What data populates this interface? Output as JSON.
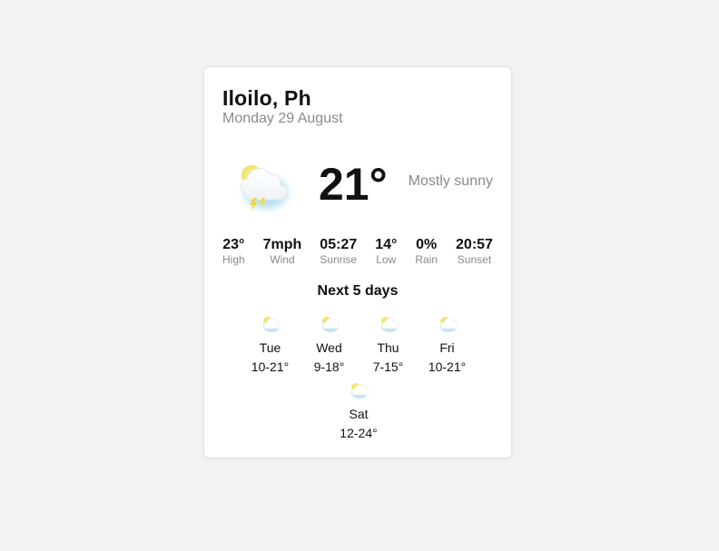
{
  "location": {
    "city": "Iloilo, Ph",
    "date": "Monday 29 August"
  },
  "current": {
    "icon": "partly-cloudy-thunder-icon",
    "temperature": "21°",
    "summary": "Mostly sunny"
  },
  "stats": [
    {
      "value": "23°",
      "label": "High"
    },
    {
      "value": "7mph",
      "label": "Wind"
    },
    {
      "value": "05:27",
      "label": "Sunrise"
    },
    {
      "value": "14°",
      "label": "Low"
    },
    {
      "value": "0%",
      "label": "Rain"
    },
    {
      "value": "20:57",
      "label": "Sunset"
    }
  ],
  "forecast_title": "Next 5 days",
  "forecast": [
    {
      "day": "Tue",
      "range": "10-21°",
      "icon": "partly-cloudy-icon"
    },
    {
      "day": "Wed",
      "range": "9-18°",
      "icon": "partly-cloudy-icon"
    },
    {
      "day": "Thu",
      "range": "7-15°",
      "icon": "partly-cloudy-icon"
    },
    {
      "day": "Fri",
      "range": "10-21°",
      "icon": "partly-cloudy-icon"
    },
    {
      "day": "Sat",
      "range": "12-24°",
      "icon": "partly-cloudy-icon"
    }
  ],
  "colors": {
    "background": "#f2f2f2",
    "card": "#ffffff",
    "muted_text": "#8a8a8a",
    "sun": "#f3e56a",
    "cloud_shadow": "#8fd0f0"
  }
}
